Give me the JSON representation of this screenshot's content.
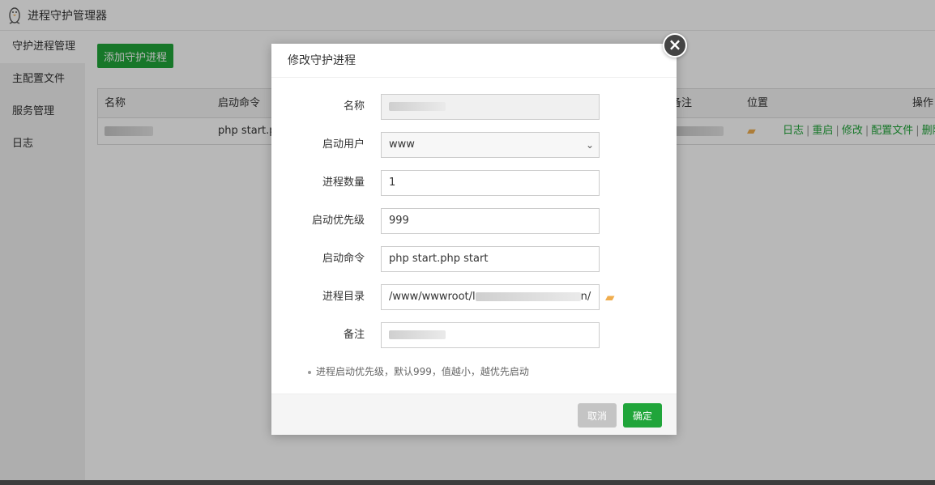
{
  "app": {
    "title": "进程守护管理器",
    "logo_icon": "linux-penguin-icon"
  },
  "sidebar": {
    "items": [
      {
        "label": "守护进程管理",
        "active": true
      },
      {
        "label": "主配置文件",
        "active": false
      },
      {
        "label": "服务管理",
        "active": false
      },
      {
        "label": "日志",
        "active": false
      }
    ]
  },
  "main": {
    "add_button": "添加守护进程",
    "table": {
      "headers": [
        "名称",
        "启动命令",
        "备注",
        "位置",
        "操作"
      ],
      "rows": [
        {
          "command": "php start.pl",
          "location_icon": "folder-icon",
          "actions": [
            "日志",
            "重启",
            "修改",
            "配置文件",
            "删除"
          ],
          "separator": "|"
        }
      ]
    }
  },
  "modal": {
    "title": "修改守护进程",
    "close_icon": "close-icon",
    "fields": {
      "name": {
        "label": "名称"
      },
      "user": {
        "label": "启动用户",
        "value": "www"
      },
      "count": {
        "label": "进程数量",
        "value": "1"
      },
      "priority": {
        "label": "启动优先级",
        "value": "999"
      },
      "command": {
        "label": "启动命令",
        "value": "php start.php start"
      },
      "directory": {
        "label": "进程目录",
        "prefix": "/www/wwwroot/l",
        "suffix": "n/"
      },
      "note": {
        "label": "备注"
      }
    },
    "tip": "进程启动优先级，默认999，值越小，越优先启动",
    "buttons": {
      "cancel": "取消",
      "ok": "确定"
    }
  },
  "colors": {
    "primary": "#20a53a",
    "folder": "#f0ad4e",
    "overlay": "rgba(0,0,0,0.28)"
  }
}
